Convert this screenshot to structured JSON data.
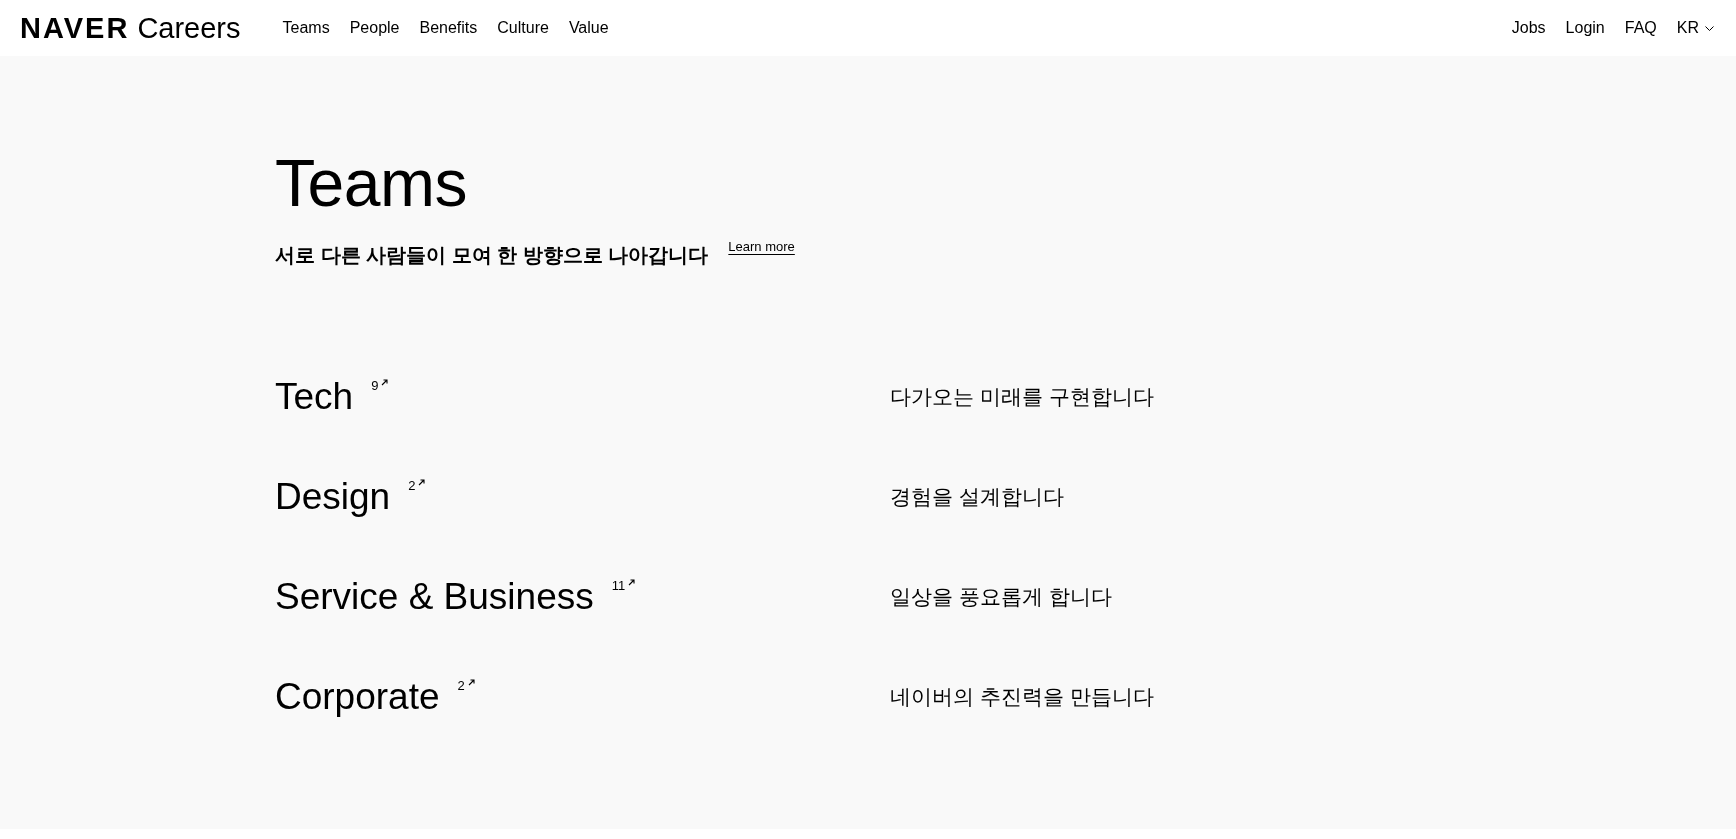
{
  "header": {
    "logo": {
      "brand": "NAVER",
      "product": "Careers"
    },
    "nav": [
      {
        "label": "Teams"
      },
      {
        "label": "People"
      },
      {
        "label": "Benefits"
      },
      {
        "label": "Culture"
      },
      {
        "label": "Value"
      }
    ],
    "utility": [
      {
        "label": "Jobs"
      },
      {
        "label": "Login"
      },
      {
        "label": "FAQ"
      }
    ],
    "language": {
      "label": "KR"
    }
  },
  "hero": {
    "title": "Teams",
    "subtitle": "서로 다른 사람들이 모여 한 방향으로 나아갑니다",
    "link": "Learn more"
  },
  "teams": [
    {
      "name": "Tech",
      "count": "9",
      "description": "다가오는 미래를 구현합니다"
    },
    {
      "name": "Design",
      "count": "2",
      "description": "경험을 설계합니다"
    },
    {
      "name": "Service & Business",
      "count": "11",
      "description": "일상을 풍요롭게 합니다"
    },
    {
      "name": "Corporate",
      "count": "2",
      "description": "네이버의 추진력을 만듭니다"
    }
  ]
}
